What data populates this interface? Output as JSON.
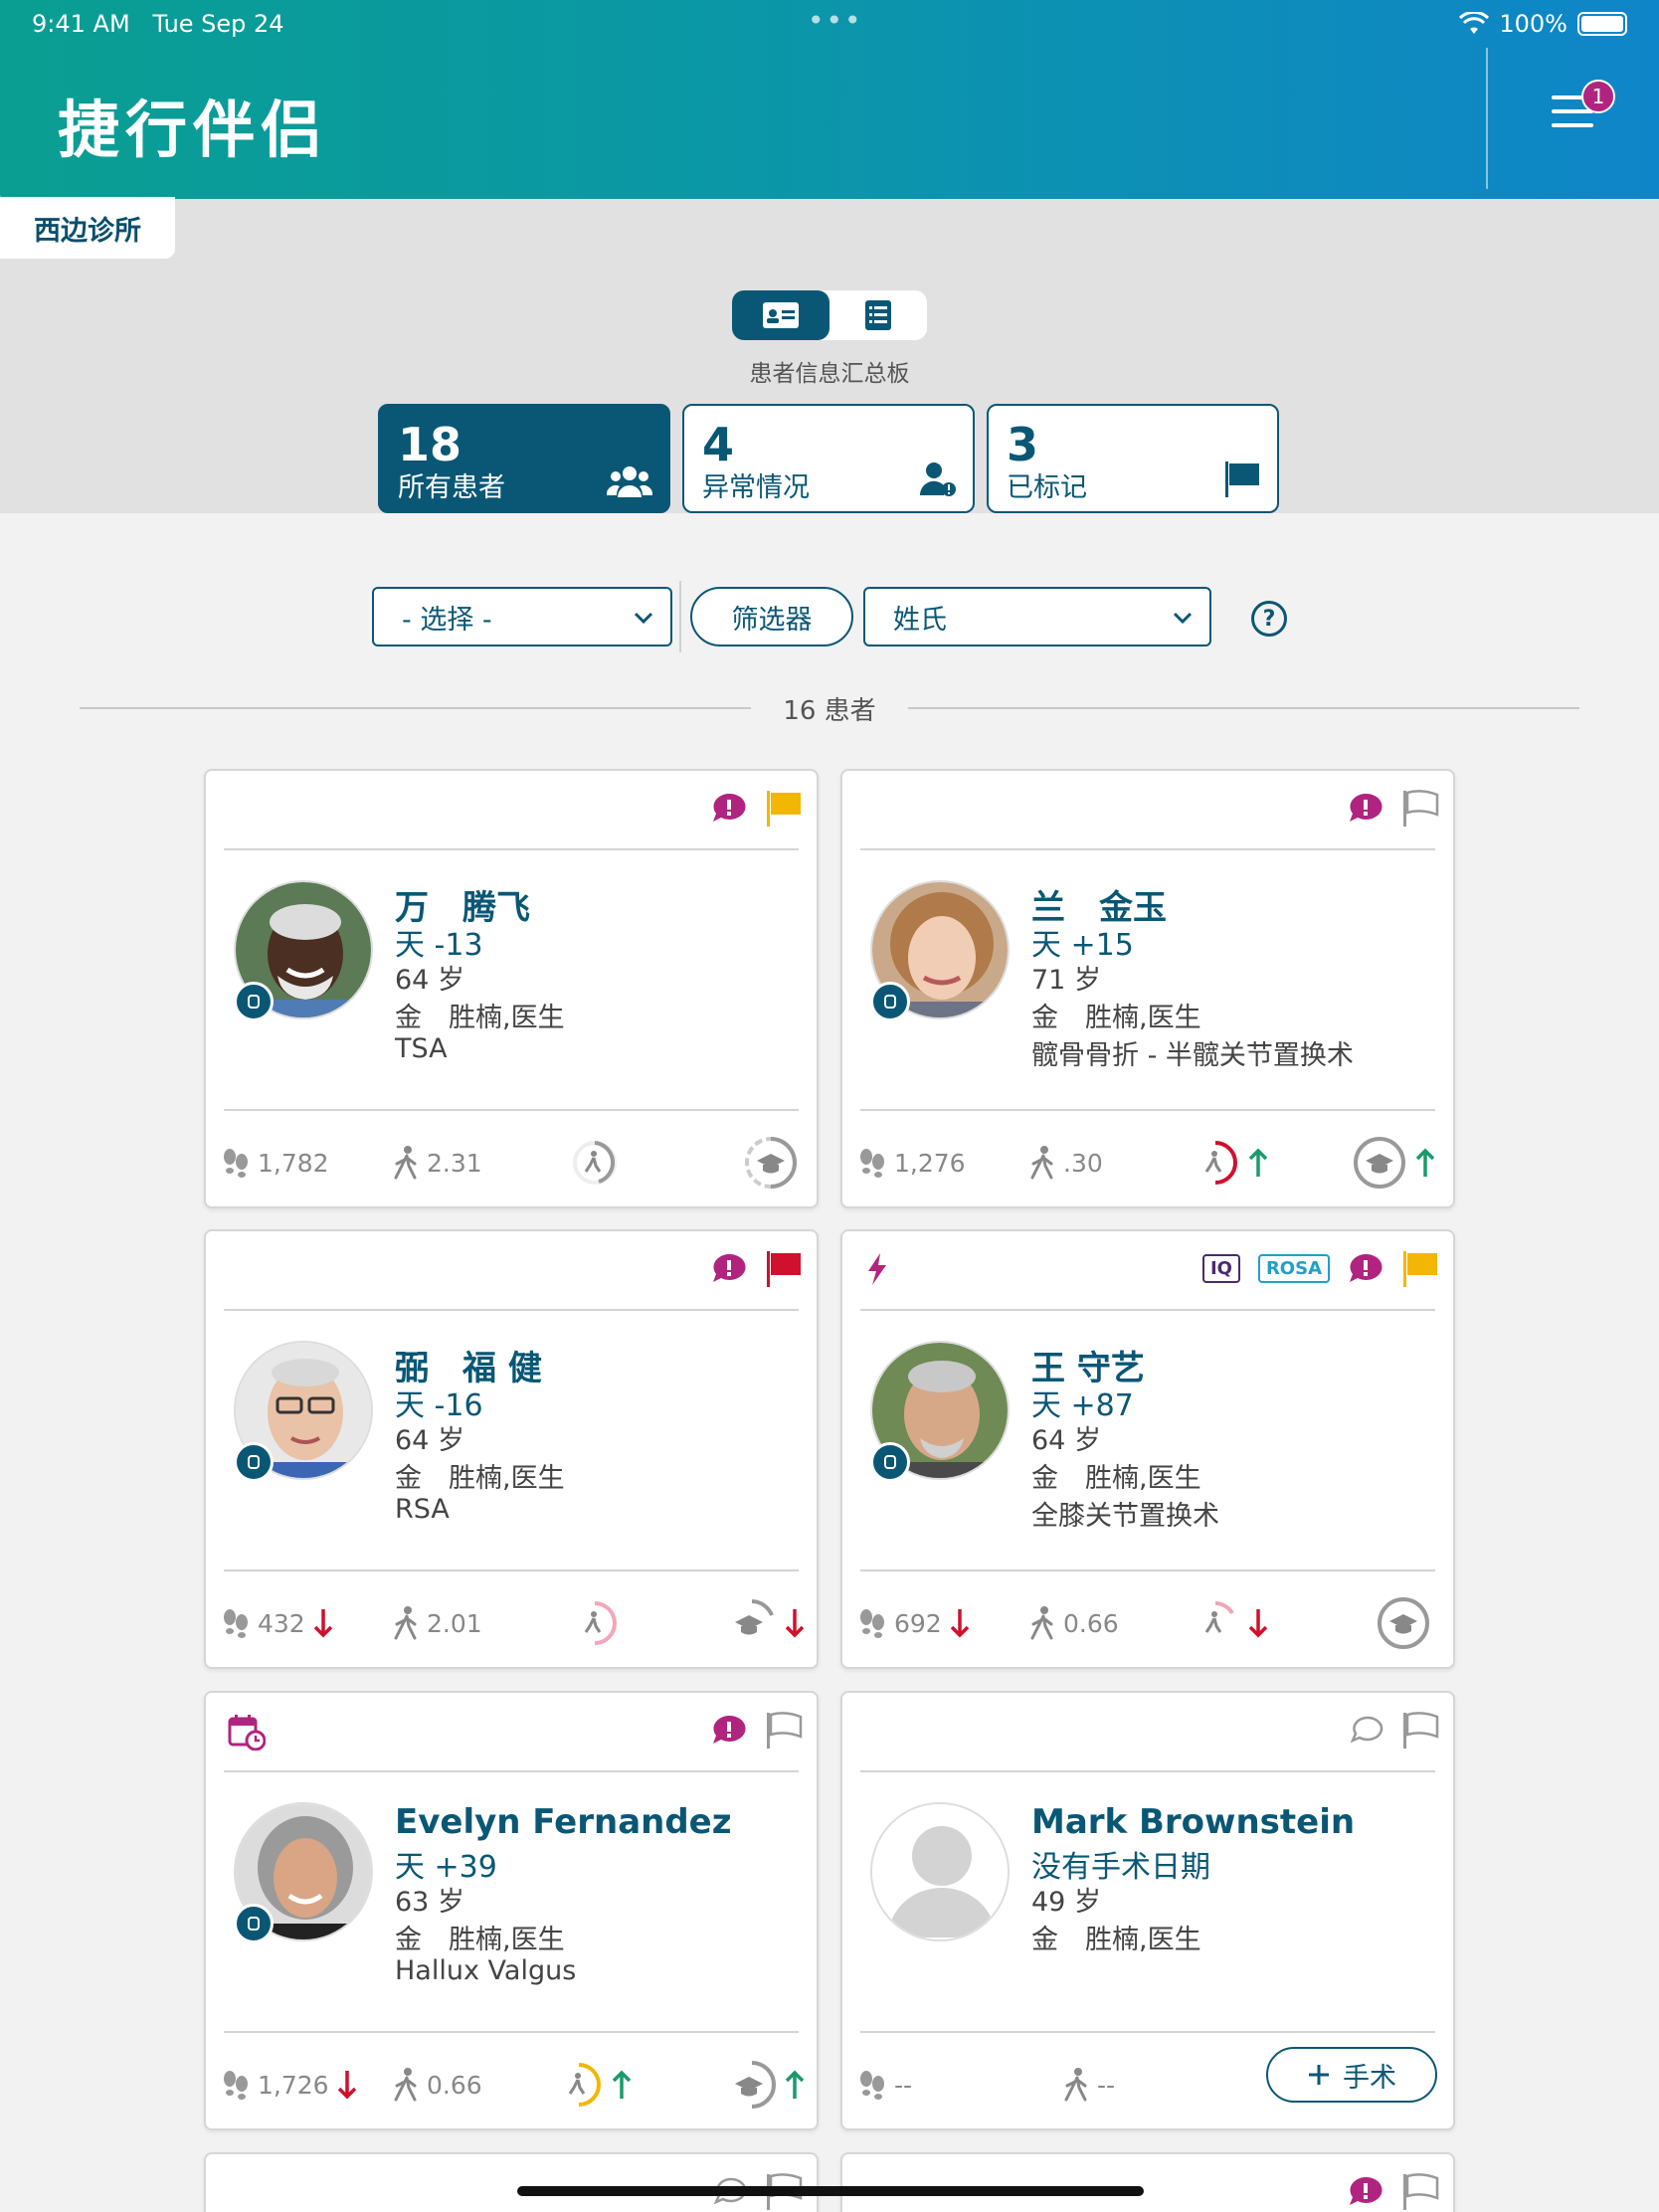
{
  "status_bar": {
    "time": "9:41 AM",
    "date": "Tue Sep 24",
    "battery": "100%"
  },
  "header": {
    "app_title": "捷行伴侣",
    "menu_badge": "1"
  },
  "clinic": {
    "name": "西边诊所"
  },
  "dashboard": {
    "view_label": "患者信息汇总板",
    "active_view": "card",
    "stats": [
      {
        "number": "18",
        "label": "所有患者",
        "icon": "group-icon",
        "active": true
      },
      {
        "number": "4",
        "label": "异常情况",
        "icon": "user-alert-icon",
        "active": false
      },
      {
        "number": "3",
        "label": "已标记",
        "icon": "flag-icon",
        "active": false
      }
    ]
  },
  "filters": {
    "select_value": "- 选择 -",
    "filter_label": "筛选器",
    "sort_value": "姓氏",
    "help": "?"
  },
  "patient_count": "16 患者",
  "patients": [
    {
      "name": "万　腾飞",
      "day": "天 -13",
      "age": "64 岁",
      "doctor": "金　胜楠,医生",
      "procedure": "TSA",
      "steps": "1,782",
      "steps_trend": "",
      "walk": "2.31",
      "flag": "yellow",
      "alert": true
    },
    {
      "name": "兰　金玉",
      "day": "天 +15",
      "age": "71 岁",
      "doctor": "金　胜楠,医生",
      "procedure": "髋骨骨折 - 半髋关节置换术",
      "steps": "1,276",
      "steps_trend": "",
      "walk": ".30",
      "flag": "outline",
      "alert": true
    },
    {
      "name": "弼　福 健",
      "day": "天 -16",
      "age": "64 岁",
      "doctor": "金　胜楠,医生",
      "procedure": "RSA",
      "steps": "432",
      "steps_trend": "down",
      "walk": "2.01",
      "flag": "red",
      "alert": true
    },
    {
      "name": "王 守艺",
      "day": "天 +87",
      "age": "64 岁",
      "doctor": "金　胜楠,医生",
      "procedure": "全膝关节置换术",
      "steps": "692",
      "steps_trend": "down",
      "walk": "0.66",
      "flag": "yellow",
      "alert": true,
      "tags": [
        "IQ",
        "ROSA"
      ]
    },
    {
      "name": "Evelyn Fernandez",
      "day": "天 +39",
      "age": "63 岁",
      "doctor": "金　胜楠,医生",
      "procedure": "Hallux Valgus",
      "steps": "1,726",
      "steps_trend": "down",
      "walk": "0.66",
      "flag": "outline",
      "alert": true
    },
    {
      "name": "Mark Brownstein",
      "day": "没有手术日期",
      "age": "49 岁",
      "doctor": "金　胜楠,医生",
      "procedure": "",
      "steps": "--",
      "steps_trend": "",
      "walk": "--",
      "flag": "outline",
      "alert": false,
      "surgery_button": "手术"
    }
  ],
  "colors": {
    "primary": "#0a5775",
    "alert": "#b0247f",
    "flag_yellow": "#f2b705",
    "flag_red": "#d0102c",
    "up": "#1a9a6a",
    "down": "#d0102c"
  }
}
